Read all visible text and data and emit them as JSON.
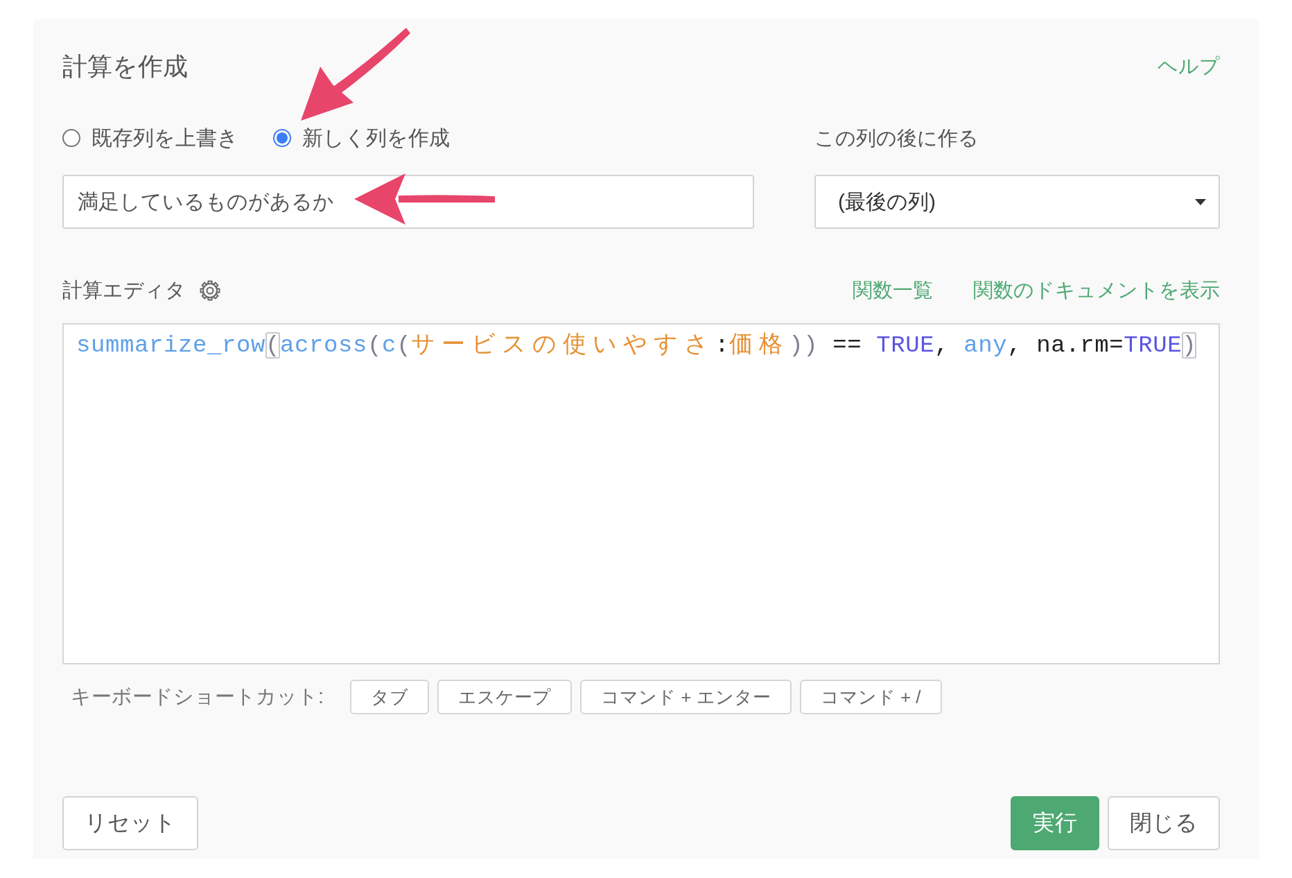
{
  "dialog": {
    "title": "計算を作成",
    "help_link": "ヘルプ",
    "mode_options": [
      {
        "label": "既存列を上書き",
        "selected": false
      },
      {
        "label": "新しく列を作成",
        "selected": true
      }
    ],
    "column_name": {
      "value": "満足しているものがあるか"
    },
    "position": {
      "label": "この列の後に作る",
      "value": "(最後の列)"
    },
    "editor": {
      "label": "計算エディタ",
      "links": [
        "関数一覧",
        "関数のドキュメントを表示"
      ],
      "code_tokens": [
        {
          "text": "summarize_row",
          "kind": "function"
        },
        {
          "text": "(",
          "kind": "matched-bracket"
        },
        {
          "text": "across",
          "kind": "function"
        },
        {
          "text": "(",
          "kind": "bracket"
        },
        {
          "text": "c",
          "kind": "function"
        },
        {
          "text": "(",
          "kind": "bracket"
        },
        {
          "text": "サービスの使いやすさ",
          "kind": "column"
        },
        {
          "text": ":",
          "kind": "plain"
        },
        {
          "text": "価格",
          "kind": "column"
        },
        {
          "text": "))",
          "kind": "bracket"
        },
        {
          "text": " == ",
          "kind": "plain"
        },
        {
          "text": "TRUE",
          "kind": "constant"
        },
        {
          "text": ", ",
          "kind": "plain"
        },
        {
          "text": "any",
          "kind": "function"
        },
        {
          "text": ", na.rm=",
          "kind": "plain"
        },
        {
          "text": "TRUE",
          "kind": "constant"
        },
        {
          "text": ")",
          "kind": "matched-bracket"
        }
      ]
    },
    "shortcuts": {
      "label": "キーボードショートカット:",
      "keys": [
        "タブ",
        "エスケープ",
        "コマンド + エンター",
        "コマンド + /"
      ]
    },
    "buttons": [
      {
        "label": "リセット",
        "kind": "secondary"
      },
      {
        "label": "実行",
        "kind": "primary"
      },
      {
        "label": "閉じる",
        "kind": "secondary"
      }
    ]
  }
}
